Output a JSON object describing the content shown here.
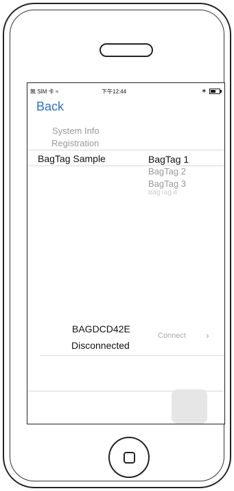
{
  "status_bar": {
    "carrier": "無 SIM 卡 ≈",
    "time": "下午12:44",
    "bluetooth_icon": "bluetooth-icon",
    "battery_icon": "battery-icon"
  },
  "nav": {
    "back_label": "Back"
  },
  "menu": {
    "system_info": "System Info",
    "registration": "Registration"
  },
  "sample_label": "BagTag Sample",
  "picker": {
    "selected": "BagTag 1",
    "options": [
      "BagTag 2",
      "BagTag 3",
      "BagTag 4"
    ]
  },
  "device": {
    "name": "BAGDCD42E",
    "status": "Disconnected",
    "connect_label": "Connect",
    "chevron": "›"
  }
}
